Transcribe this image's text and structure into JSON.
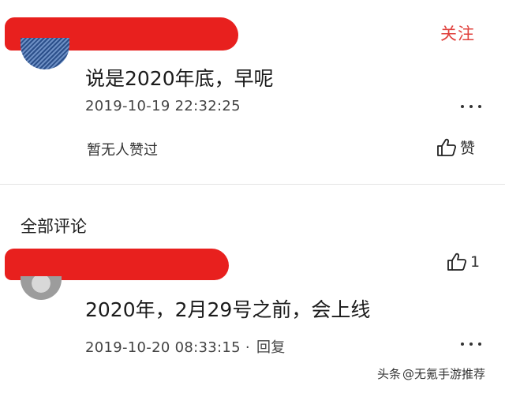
{
  "header_comment": {
    "follow_label": "关注",
    "text": "说是2020年底，早呢",
    "timestamp": "2019-10-19 22:32:25",
    "likes_status": "暂无人赞过",
    "like_label": "赞"
  },
  "comments_section": {
    "title": "全部评论",
    "comments": [
      {
        "text": "2020年，2月29号之前，会上线",
        "timestamp": "2019-10-20 08:33:15",
        "separator": "·",
        "reply_label": "回复",
        "like_count": "1"
      }
    ]
  },
  "watermark": {
    "source": "头条",
    "handle": "@无氪手游推荐"
  },
  "colors": {
    "accent": "#e0403c",
    "redaction": "#e8201e"
  },
  "icons": {
    "like": "thumbs-up-icon",
    "more": "more-horizontal-icon"
  }
}
